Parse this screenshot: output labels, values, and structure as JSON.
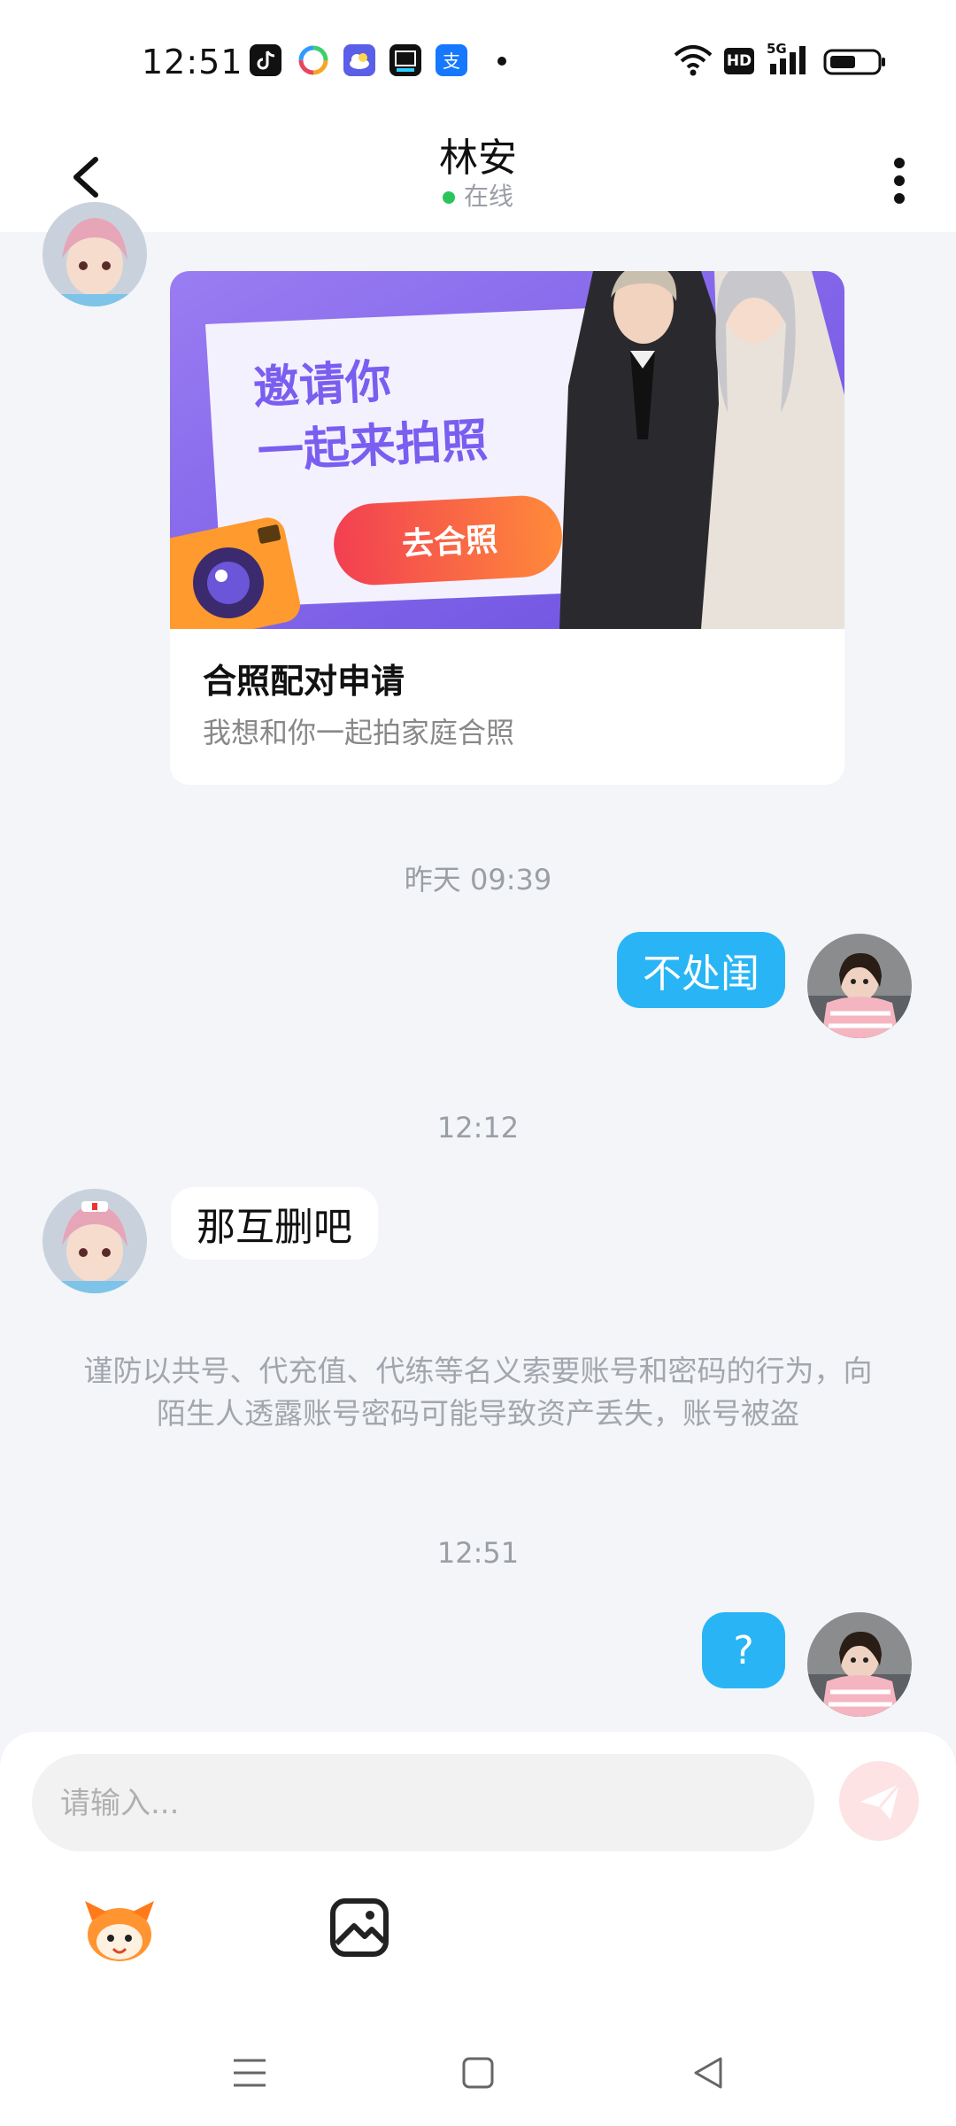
{
  "status_bar": {
    "time": "12:51",
    "icons": [
      "douyin-icon",
      "wallpaper-app-icon",
      "weather-icon",
      "news-app-icon",
      "alipay-icon",
      "notification-dot"
    ],
    "indicators": [
      "wifi-icon",
      "hd-icon",
      "5g-signal-icon",
      "battery-icon"
    ],
    "hd_label": "HD",
    "network_label": "5G"
  },
  "header": {
    "title": "林安",
    "status": "在线",
    "status_color": "#2bc45a"
  },
  "card": {
    "banner_headline_line1": "邀请你",
    "banner_headline_line2": "一起来拍照",
    "banner_button": "去合照",
    "title": "合照配对申请",
    "subtitle": "我想和你一起拍家庭合照"
  },
  "messages": {
    "ts1": "昨天 09:39",
    "out1": "不处闺",
    "ts2": "12:12",
    "in1": "那互删吧",
    "warning": "谨防以共号、代充值、代练等名义索要账号和密码的行为，向陌生人透露账号密码可能导致资产丢失，账号被盗",
    "ts3": "12:51",
    "out2": "?"
  },
  "input": {
    "placeholder": "请输入..."
  },
  "toolbar": {
    "items": [
      "mascot-emoji-icon",
      "image-icon"
    ]
  },
  "colors": {
    "accent": "#29b5f5",
    "background": "#f3f5f8",
    "send_disabled": "#fde3e4",
    "banner_purple": "#7e63ea",
    "banner_button": "#f2533d"
  }
}
